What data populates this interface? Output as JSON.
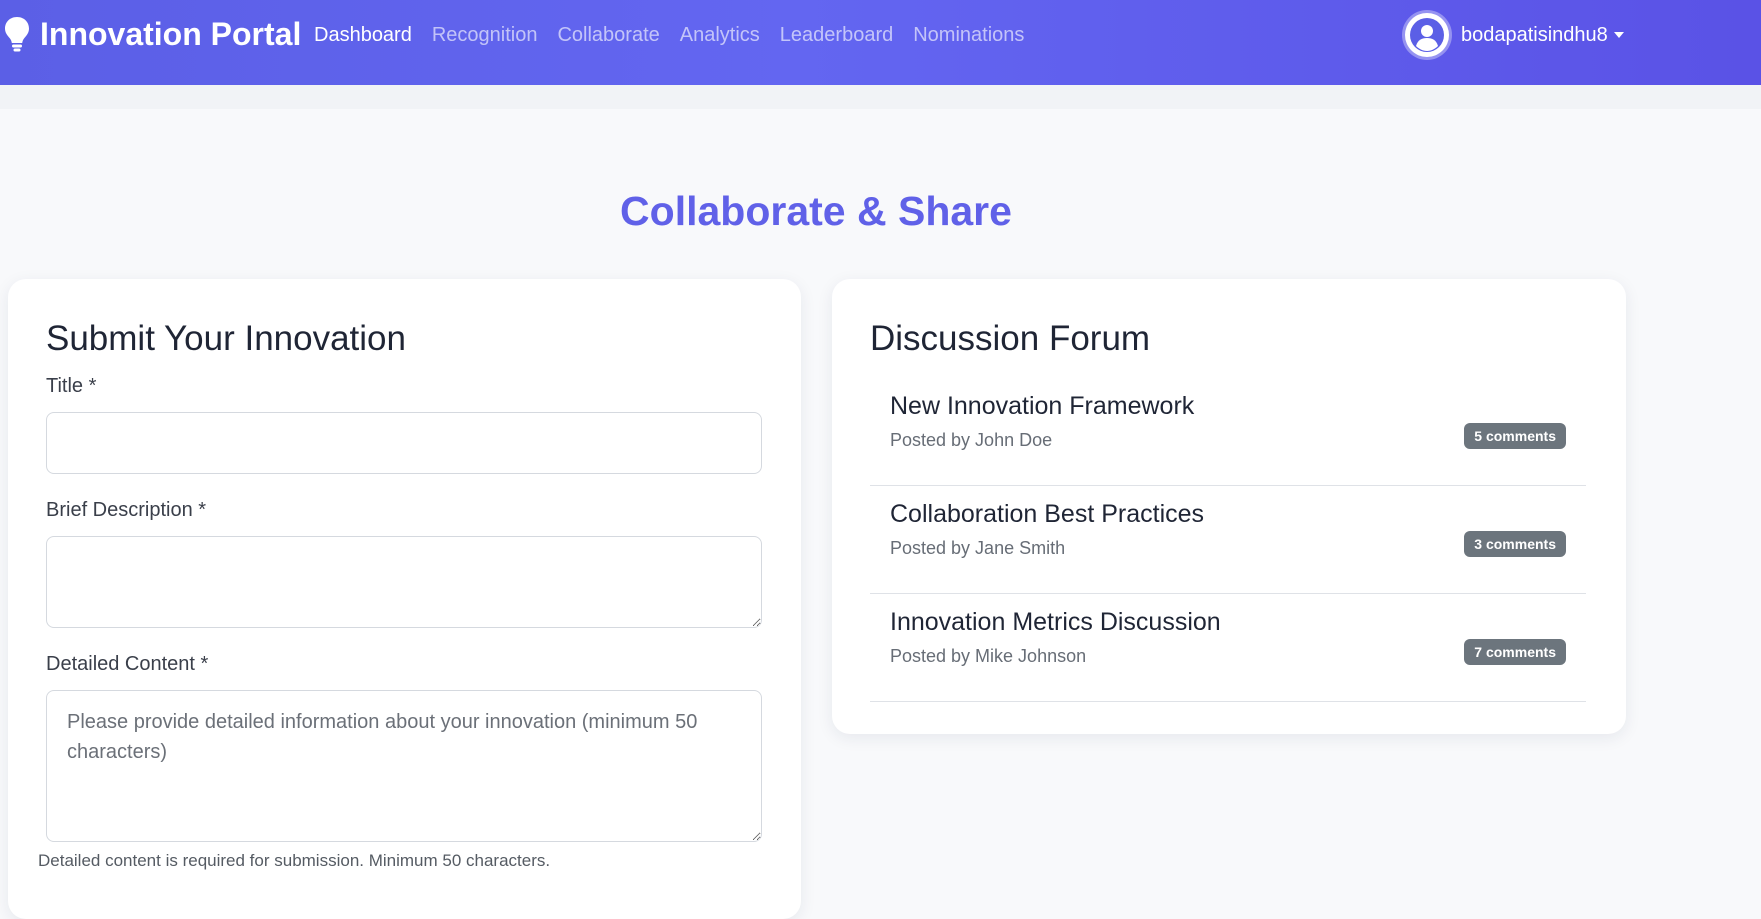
{
  "navbar": {
    "brand": "Innovation Portal",
    "links": [
      "Dashboard",
      "Recognition",
      "Collaborate",
      "Analytics",
      "Leaderboard",
      "Nominations"
    ],
    "active": "Dashboard",
    "username": "bodapatisindhu8",
    "accent": "#6366f1"
  },
  "page": {
    "title": "Collaborate & Share"
  },
  "submit": {
    "heading": "Submit Your Innovation",
    "title_label": "Title *",
    "title_value": "",
    "brief_label": "Brief Description *",
    "brief_value": "",
    "detail_label": "Detailed Content *",
    "detail_placeholder": "Please provide detailed information about your innovation (minimum 50 characters)",
    "detail_help": "Detailed content is required for submission. Minimum 50 characters."
  },
  "forum": {
    "heading": "Discussion Forum",
    "posts": [
      {
        "title": "New Innovation Framework",
        "author": "Posted by John Doe",
        "comments": "5 comments"
      },
      {
        "title": "Collaboration Best Practices",
        "author": "Posted by Jane Smith",
        "comments": "3 comments"
      },
      {
        "title": "Innovation Metrics Discussion",
        "author": "Posted by Mike Johnson",
        "comments": "7 comments"
      }
    ]
  }
}
